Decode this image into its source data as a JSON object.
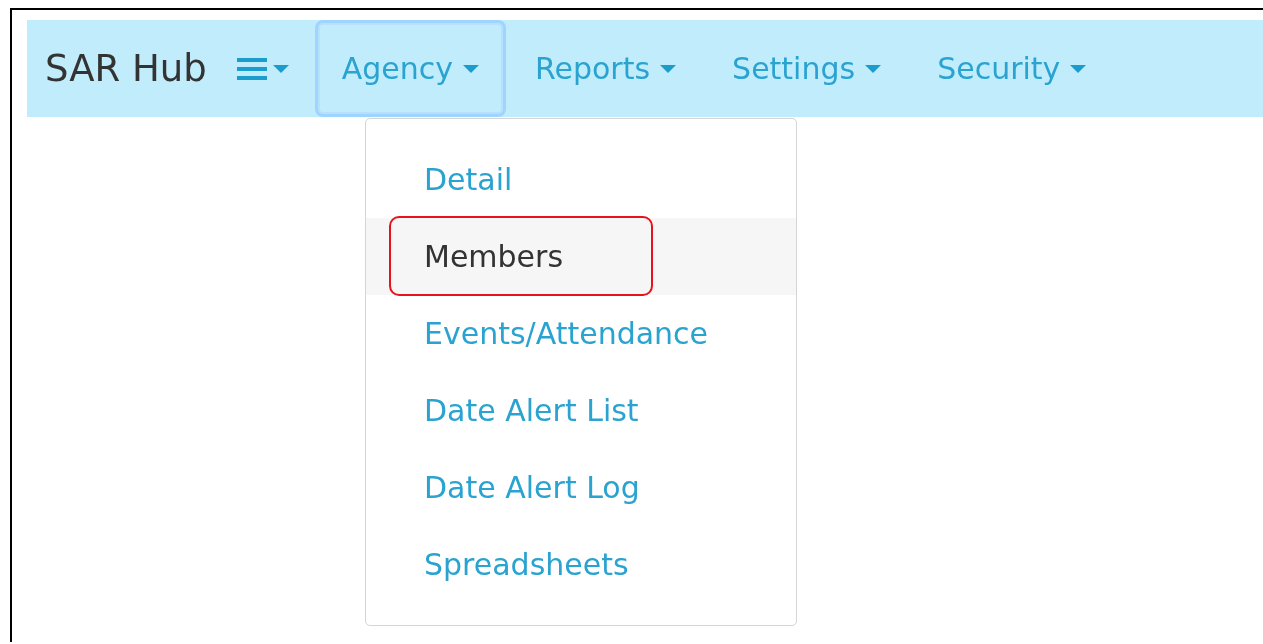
{
  "navbar": {
    "brand": "SAR Hub",
    "items": [
      {
        "label": "Agency",
        "expanded": true
      },
      {
        "label": "Reports",
        "expanded": false
      },
      {
        "label": "Settings",
        "expanded": false
      },
      {
        "label": "Security",
        "expanded": false
      }
    ]
  },
  "dropdown": {
    "items": [
      {
        "label": "Detail",
        "selected": false
      },
      {
        "label": "Members",
        "selected": true
      },
      {
        "label": "Events/Attendance",
        "selected": false
      },
      {
        "label": "Date Alert List",
        "selected": false
      },
      {
        "label": "Date Alert Log",
        "selected": false
      },
      {
        "label": "Spreadsheets",
        "selected": false
      }
    ]
  }
}
